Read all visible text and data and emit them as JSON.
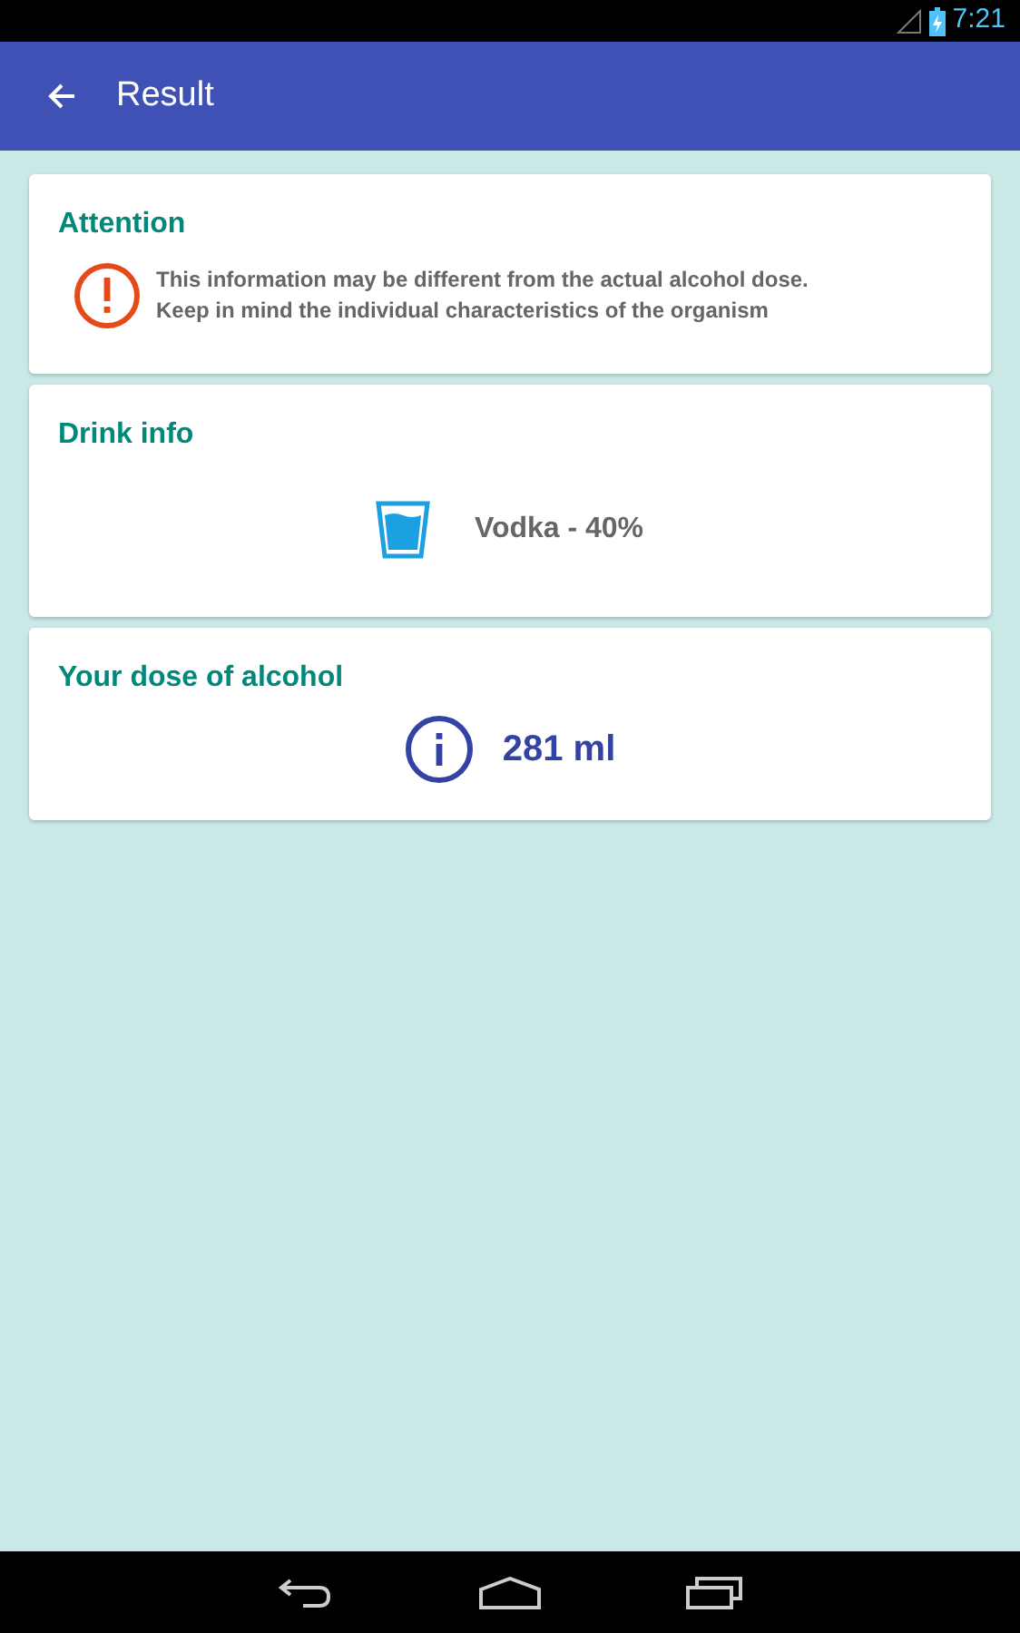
{
  "status_bar": {
    "time": "7:21"
  },
  "app_bar": {
    "title": "Result"
  },
  "cards": [
    {
      "kind": "warning",
      "title": "Attention",
      "lines": [
        "This information may be different from the actual alcohol dose.",
        "Keep in mind the individual characteristics of the organism"
      ]
    },
    {
      "kind": "drink",
      "title": "Drink info",
      "value": "Vodka - 40%"
    },
    {
      "kind": "dose",
      "title": "Your dose of alcohol",
      "value": "281 ml"
    }
  ]
}
